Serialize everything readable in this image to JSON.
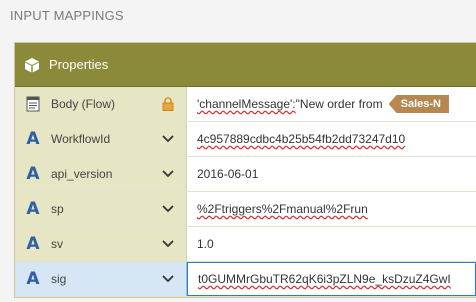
{
  "section_title": "INPUT MAPPINGS",
  "panel": {
    "title": "Properties",
    "icon": "cube-icon"
  },
  "rows": [
    {
      "label": "Body (Flow)",
      "type": "document",
      "control": "lock-icon",
      "value_prefix": "'channelMessage':",
      "value_rest": "\"New order from",
      "token": "Sales-N"
    },
    {
      "label": "WorkflowId",
      "type": "string",
      "control": "chevron-down-icon",
      "value": "4c957889cdbc4b25b54fb2dd73247d10"
    },
    {
      "label": "api_version",
      "type": "string",
      "control": "chevron-down-icon",
      "value": "2016-06-01"
    },
    {
      "label": "sp",
      "type": "string",
      "control": "chevron-down-icon",
      "value": "%2Ftriggers%2Fmanual%2Frun"
    },
    {
      "label": "sv",
      "type": "string",
      "control": "chevron-down-icon",
      "value": "1.0"
    },
    {
      "label": "sig",
      "type": "string",
      "control": "chevron-down-icon",
      "value": "t0GUMMrGbuTR62qK6i3pZLN9e_ksDzuZ4GwI"
    }
  ],
  "type_glyph": "A",
  "colors": {
    "header": "#8a8a3a",
    "left_bg": "#e6e5c4",
    "selected_border": "#2b7cc4",
    "token": "#b68850"
  }
}
